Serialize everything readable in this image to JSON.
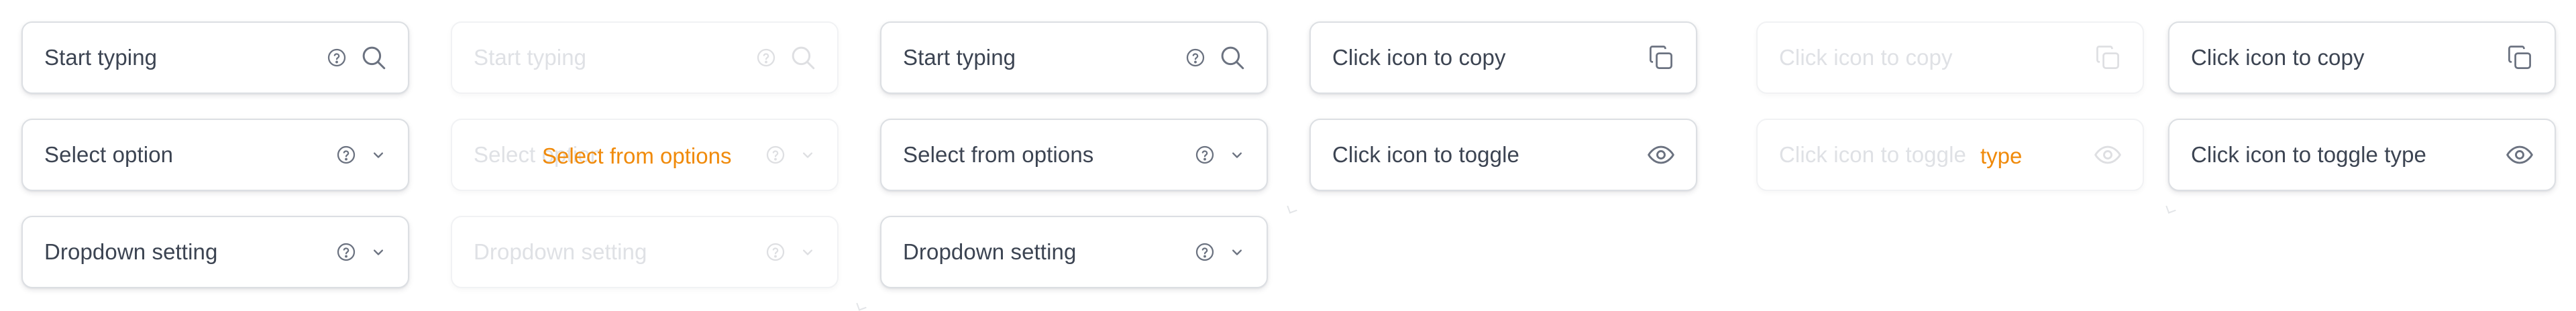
{
  "columns": {
    "col1": {
      "search_text": "Start typing",
      "select_text": "Select option",
      "dropdown_text": "Dropdown setting"
    },
    "col2": {
      "search_text": "Start typing",
      "select_text": "Select option",
      "dropdown_text": "Dropdown setting",
      "overlap_label": "Select from options"
    },
    "col3": {
      "search_text": "Start typing",
      "select_text": "Select from options",
      "dropdown_text": "Dropdown setting"
    },
    "col4": {
      "copy_text": "Click icon to copy",
      "toggle_text": "Click icon to toggle"
    },
    "col5": {
      "copy_text": "Click icon to copy",
      "toggle_text": "Click icon to toggle",
      "overlap_label": "type"
    },
    "col6": {
      "copy_text": "Click icon to copy",
      "toggle_text": "Click icon to toggle type"
    }
  },
  "icons": [
    "help-circle-icon",
    "search-icon",
    "chevron-down-icon",
    "copy-icon",
    "eye-icon"
  ],
  "colors": {
    "border": "#dcdfe3",
    "text": "#3c4452",
    "disabled_text": "#dfe1e5",
    "overlay_text": "#f08a0a"
  }
}
